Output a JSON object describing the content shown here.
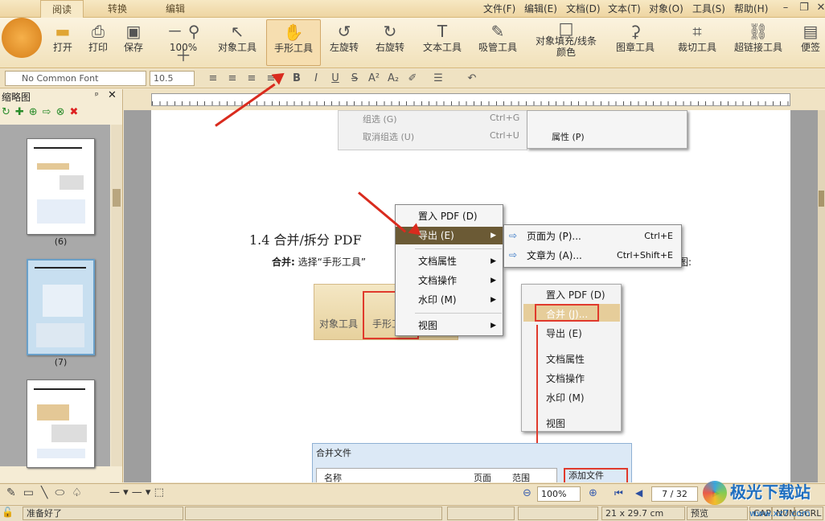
{
  "tabs": [
    "阅读",
    "转换",
    "编辑"
  ],
  "menu": [
    "文件(F)",
    "编辑(E)",
    "文档(D)",
    "文本(T)",
    "对象(O)",
    "工具(S)",
    "帮助(H)"
  ],
  "tools": [
    "打开",
    "打印",
    "保存",
    "100%",
    "对象工具",
    "手形工具",
    "左旋转",
    "右旋转",
    "文本工具",
    "吸管工具",
    "对象填充/线条",
    "颜色",
    "图章工具",
    "裁切工具",
    "超链接工具",
    "便签"
  ],
  "font": {
    "name": "No Common Font",
    "size": "10.5"
  },
  "sidebar": {
    "title": "缩略图",
    "thumbs": [
      "(6)",
      "(7)"
    ]
  },
  "doc": {
    "top_menu": [
      "组选 (G)",
      "取消组选 (U)",
      "Ctrl+G",
      "Ctrl+U",
      "属性 (P)"
    ],
    "heading": "1.4 合并/拆分 PDF",
    "para_bold": "合并:",
    "para": "选择“手形工具”",
    "para_tail": "图:",
    "embedded_tools": [
      "对象工具",
      "手形工"
    ],
    "embedded_menu": [
      "置入 PDF (D)",
      "合并 (J)...",
      "导出 (E)",
      "文档属性",
      "文档操作",
      "水印 (M)",
      "视图"
    ],
    "dialog_title": "合并文件",
    "dialog_cols": [
      "名称",
      "页面",
      "范围"
    ],
    "dialog_btn": "添加文件 (A)..."
  },
  "ctx": {
    "items": [
      "置入 PDF (D)",
      "导出 (E)",
      "文档属性",
      "文档操作",
      "水印 (M)",
      "视图"
    ]
  },
  "submenu": {
    "items": [
      "页面为 (P)...",
      "文章为 (A)..."
    ],
    "shortcuts": [
      "Ctrl+E",
      "Ctrl+Shift+E"
    ]
  },
  "bottom": {
    "zoom": "100%",
    "page": "7 / 32"
  },
  "status": {
    "text": "准备好了",
    "size": "21 x 29.7 cm",
    "preview": "预览",
    "caps": [
      "CAP",
      "NUM",
      "SCRL"
    ]
  },
  "watermark": "极光下载站",
  "watermark_url": "www.xz7.com"
}
